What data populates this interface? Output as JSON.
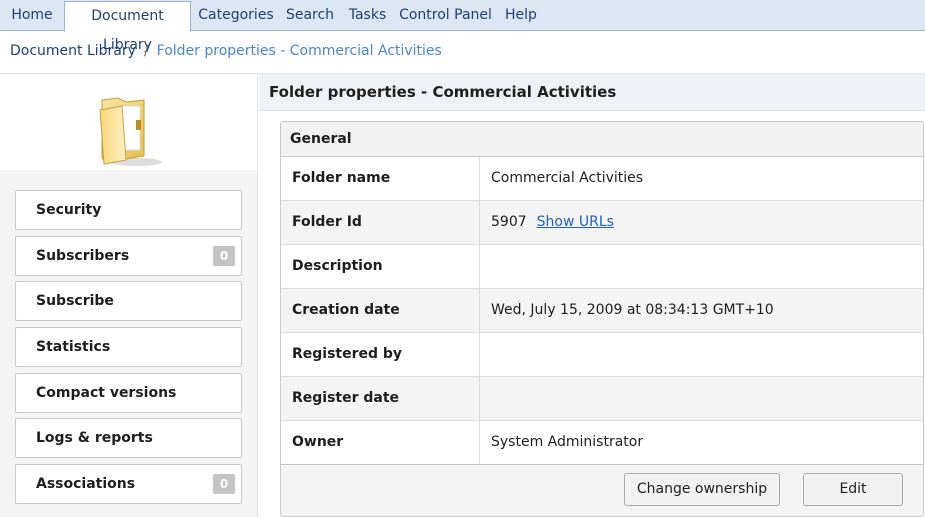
{
  "nav": {
    "tabs": [
      "Home",
      "Document Library",
      "Categories",
      "Search",
      "Tasks",
      "Control Panel",
      "Help"
    ],
    "active": "Document Library"
  },
  "breadcrumb": {
    "root": "Document Library",
    "separator": "/",
    "current": "Folder properties - Commercial Activities"
  },
  "sidebar": {
    "icon": "folder-icon",
    "items": [
      {
        "label": "Security"
      },
      {
        "label": "Subscribers",
        "badge": "0"
      },
      {
        "label": "Subscribe"
      },
      {
        "label": "Statistics"
      },
      {
        "label": "Compact versions"
      },
      {
        "label": "Logs & reports"
      },
      {
        "label": "Associations",
        "badge": "0"
      }
    ]
  },
  "main": {
    "title": "Folder properties - Commercial Activities",
    "section": "General",
    "rows": [
      {
        "label": "Folder name",
        "value": "Commercial Activities"
      },
      {
        "label": "Folder Id",
        "value": "5907",
        "link": "Show URLs"
      },
      {
        "label": "Description",
        "value": ""
      },
      {
        "label": "Creation date",
        "value": "Wed, July 15, 2009 at 08:34:13 GMT+10"
      },
      {
        "label": "Registered by",
        "value": ""
      },
      {
        "label": "Register date",
        "value": ""
      },
      {
        "label": "Owner",
        "value": "System Administrator"
      }
    ],
    "buttons": {
      "change_ownership": "Change ownership",
      "edit": "Edit"
    }
  },
  "colors": {
    "nav_bg": "#dde7f3",
    "link": "#1f5fbf",
    "breadcrumb_current": "#4a86c6"
  }
}
